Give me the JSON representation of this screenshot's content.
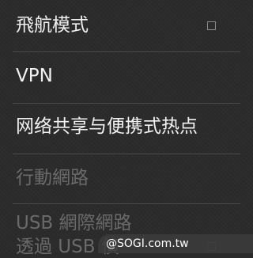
{
  "settings": {
    "items": [
      {
        "label": "飛航模式",
        "enabled": true,
        "has_checkbox": true,
        "checked": false
      },
      {
        "label": "VPN",
        "enabled": true,
        "has_checkbox": false
      },
      {
        "label": "网络共享与便携式热点",
        "enabled": true,
        "has_checkbox": false
      },
      {
        "label": "行動網路",
        "enabled": false,
        "has_checkbox": false
      },
      {
        "label": "USB 網際網路",
        "enabled": false,
        "has_checkbox": false
      },
      {
        "label": "透過 USB 偵",
        "enabled": false,
        "has_checkbox": true,
        "checked": false
      }
    ]
  },
  "watermark": {
    "text": "@SOGI.com.tw"
  },
  "colors": {
    "background": "#2b2b2b",
    "text_enabled": "#f2f2f2",
    "text_disabled": "#6a6a6a",
    "divider": "#4a4a4a"
  }
}
